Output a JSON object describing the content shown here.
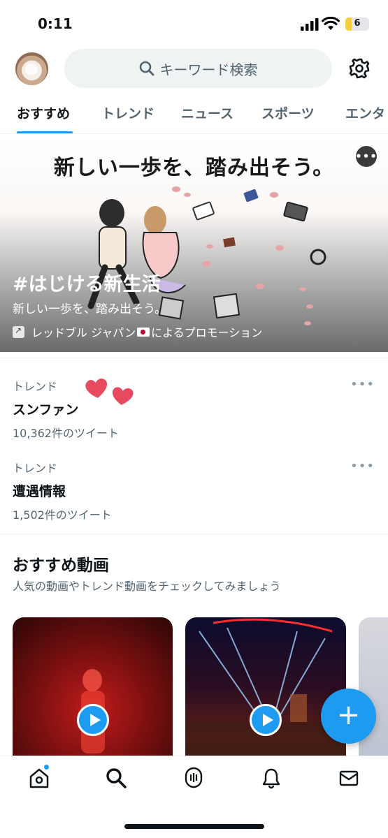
{
  "status_bar": {
    "time": "0:11",
    "battery": "6"
  },
  "header": {
    "search_placeholder": "キーワード検索"
  },
  "tabs": [
    {
      "label": "おすすめ",
      "active": true
    },
    {
      "label": "トレンド",
      "active": false
    },
    {
      "label": "ニュース",
      "active": false
    },
    {
      "label": "スポーツ",
      "active": false
    },
    {
      "label": "エンタ",
      "active": false
    }
  ],
  "promo": {
    "headline": "新しい一歩を、踏み出そう。",
    "hashtag": "#はじける新生活",
    "subtitle": "新しい一歩を、踏み出そう。",
    "advertiser": "レッドブル ジャパン",
    "promoted_suffix": "によるプロモーション"
  },
  "trends": [
    {
      "category": "トレンド",
      "name": "スンファン",
      "count": "10,362件のツイート"
    },
    {
      "category": "トレンド",
      "name": "遭遇情報",
      "count": "1,502件のツイート"
    }
  ],
  "recommended": {
    "title": "おすすめ動画",
    "subtitle": "人気の動画やトレンド動画をチェックしてみましょう"
  },
  "icons": {
    "more": "more-dots-icon",
    "compose": "plus-icon",
    "nav": [
      "home-icon",
      "search-icon",
      "spaces-icon",
      "bell-icon",
      "mail-icon"
    ]
  },
  "colors": {
    "accent": "#1d9bf0",
    "heart": "#e84a5f"
  }
}
